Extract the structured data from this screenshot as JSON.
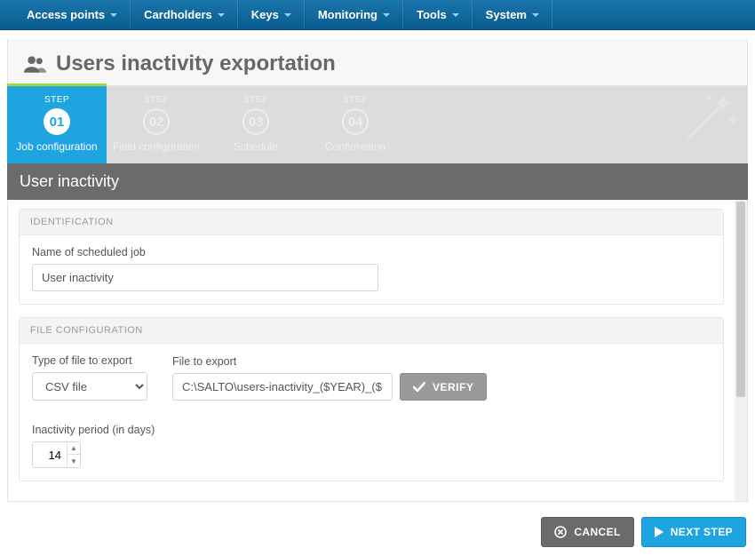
{
  "nav": {
    "items": [
      {
        "label": "Access points"
      },
      {
        "label": "Cardholders"
      },
      {
        "label": "Keys"
      },
      {
        "label": "Monitoring"
      },
      {
        "label": "Tools"
      },
      {
        "label": "System"
      }
    ]
  },
  "page": {
    "title": "Users inactivity exportation"
  },
  "wizard": {
    "step_word": "STEP",
    "steps": [
      {
        "num": "01",
        "name": "Job configuration"
      },
      {
        "num": "02",
        "name": "Field configuration"
      },
      {
        "num": "03",
        "name": "Schedule"
      },
      {
        "num": "04",
        "name": "Confirmation"
      }
    ]
  },
  "section": {
    "title": "User inactivity"
  },
  "identification": {
    "heading": "IDENTIFICATION",
    "name_label": "Name of scheduled job",
    "name_value": "User inactivity"
  },
  "fileconfig": {
    "heading": "FILE CONFIGURATION",
    "type_label": "Type of file to export",
    "type_value": "CSV file",
    "file_label": "File to export",
    "file_value": "C:\\SALTO\\users-inactivity_($YEAR)_($MONTH)_($",
    "verify_label": "VERIFY",
    "inactivity_label": "Inactivity period (in days)",
    "inactivity_value": "14"
  },
  "footer": {
    "cancel": "CANCEL",
    "next": "NEXT STEP"
  }
}
